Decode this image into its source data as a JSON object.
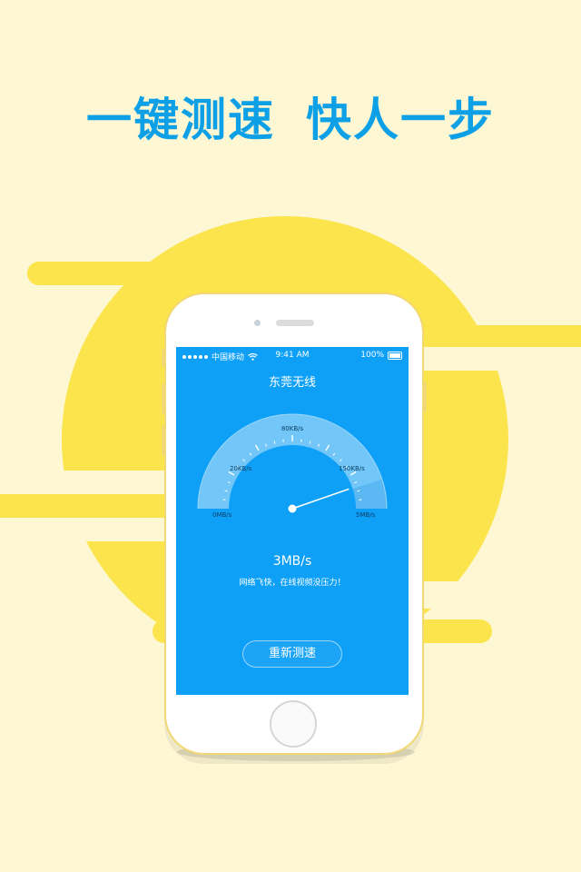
{
  "headline": {
    "part1": "一键测速",
    "part2": "快人一步"
  },
  "phone": {
    "status_bar": {
      "carrier": "中国移动",
      "time": "9:41 AM",
      "battery": "100%"
    },
    "network_name": "东莞无线",
    "gauge": {
      "labels": [
        "0MB/s",
        "20KB/s",
        "80KB/s",
        "150KB/s",
        "5MB/s"
      ],
      "current_fraction": 0.9
    },
    "speed": "3MB/s",
    "tip": "网络飞快，在线视频没压力！",
    "retest_label": "重新测速"
  },
  "colors": {
    "background": "#fdf7d4",
    "accent_yellow": "#fbe44c",
    "headline_blue": "#0ea0e6",
    "screen_blue": "#0ea0f7"
  }
}
